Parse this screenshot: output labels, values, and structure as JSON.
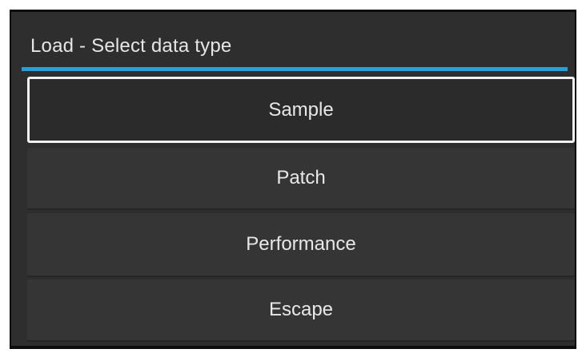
{
  "dialog": {
    "title": "Load - Select data type",
    "accent_color": "#2a9fd6",
    "options": [
      {
        "label": "Sample",
        "focused": true
      },
      {
        "label": "Patch",
        "focused": false
      },
      {
        "label": "Performance",
        "focused": false
      },
      {
        "label": "Escape",
        "focused": false
      }
    ]
  }
}
